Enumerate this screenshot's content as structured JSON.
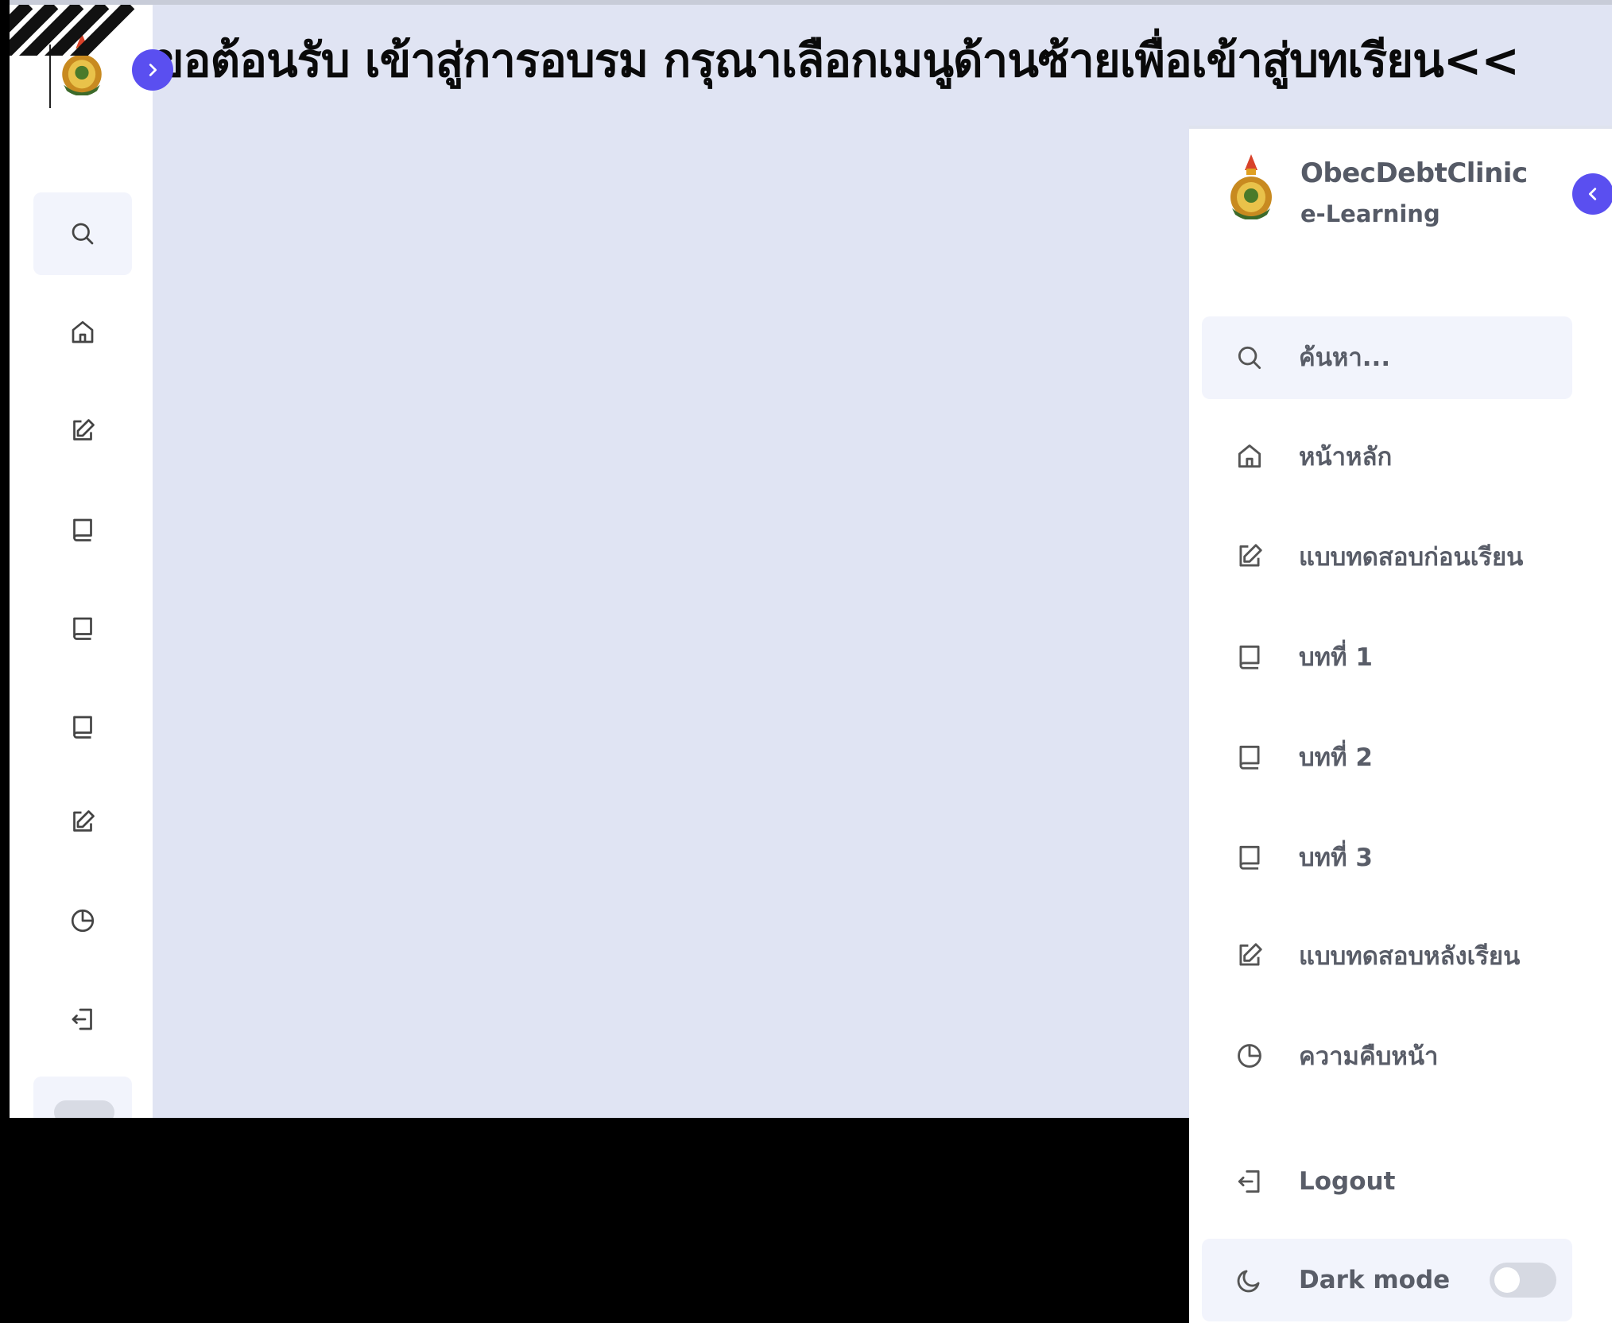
{
  "banner": {
    "text": "ขอต้อนรับ เข้าสู่การอบรม กรุณาเลือกเมนูด้านซ้ายเพื่อเข้าสู่บทเรียน<<"
  },
  "brand": {
    "title": "ObecDebtClinic",
    "subtitle": "e-Learning"
  },
  "search": {
    "placeholder": "ค้นหา..."
  },
  "menu": {
    "items": [
      {
        "label": "หน้าหลัก",
        "icon": "home-icon"
      },
      {
        "label": "แบบทดสอบก่อนเรียน",
        "icon": "edit-icon"
      },
      {
        "label": "บทที่ 1",
        "icon": "book-icon"
      },
      {
        "label": "บทที่ 2",
        "icon": "book-icon"
      },
      {
        "label": "บทที่ 3",
        "icon": "book-icon"
      },
      {
        "label": "แบบทดสอบหลังเรียน",
        "icon": "edit-icon"
      },
      {
        "label": "ความคืบหน้า",
        "icon": "pie-chart-icon"
      }
    ],
    "logout": {
      "label": "Logout",
      "icon": "logout-icon"
    },
    "dark_mode": {
      "label": "Dark mode",
      "icon": "moon-icon",
      "enabled": false
    }
  },
  "colors": {
    "accent": "#5a4ff0",
    "page_background": "#e0e4f3",
    "sidebar_background": "#ffffff",
    "text": "#595d68"
  }
}
